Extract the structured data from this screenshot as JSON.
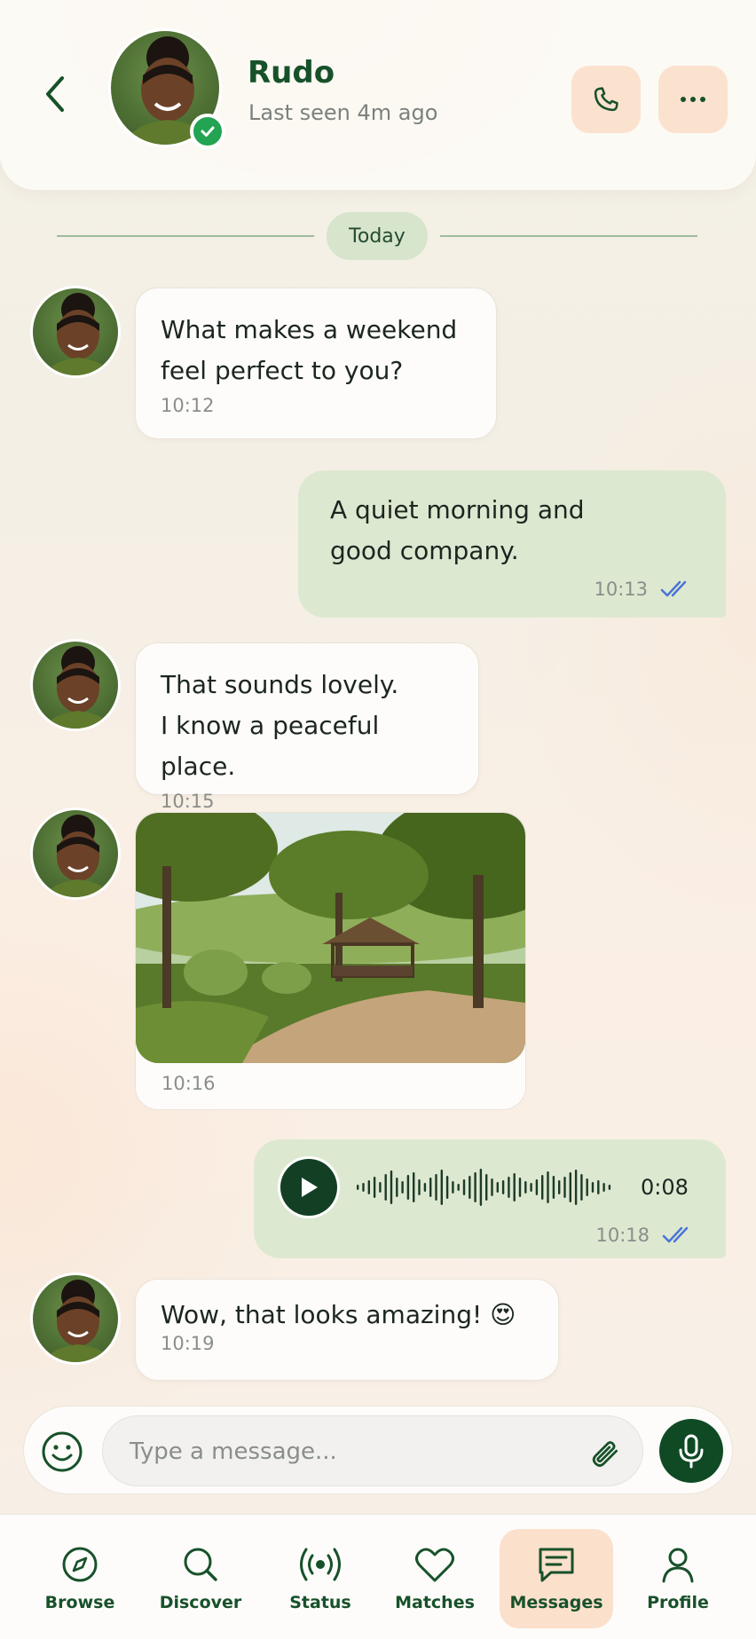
{
  "header": {
    "contact_name": "Rudo",
    "last_seen": "Last seen 4m ago"
  },
  "date_divider": "Today",
  "messages": [
    {
      "direction": "in",
      "text": "What makes a weekend\nfeel perfect to you?",
      "time": "10:12"
    },
    {
      "direction": "out",
      "text": "A quiet morning and\ngood company.",
      "time": "10:13",
      "status": "read"
    },
    {
      "direction": "in",
      "text": "That sounds lovely.\nI know a peaceful place.",
      "time": "10:15"
    },
    {
      "direction": "in",
      "type": "image",
      "time": "10:16"
    },
    {
      "direction": "out",
      "type": "voice",
      "duration": "0:08",
      "time": "10:18",
      "status": "read"
    },
    {
      "direction": "in",
      "text": "Wow, that looks amazing! 😍",
      "time": "10:19"
    }
  ],
  "composer": {
    "placeholder": "Type a message..."
  },
  "nav": [
    {
      "label": "Browse",
      "icon": "compass-icon"
    },
    {
      "label": "Discover",
      "icon": "search-icon"
    },
    {
      "label": "Status",
      "icon": "broadcast-icon"
    },
    {
      "label": "Matches",
      "icon": "heart-icon"
    },
    {
      "label": "Messages",
      "icon": "chat-icon",
      "active": true
    },
    {
      "label": "Profile",
      "icon": "person-icon"
    }
  ],
  "colors": {
    "brand_green": "#17512a",
    "accent_peach": "#fbe0cc",
    "out_bubble": "#dde8d1",
    "read_ticks": "#4a74d8",
    "verified": "#22a452"
  }
}
